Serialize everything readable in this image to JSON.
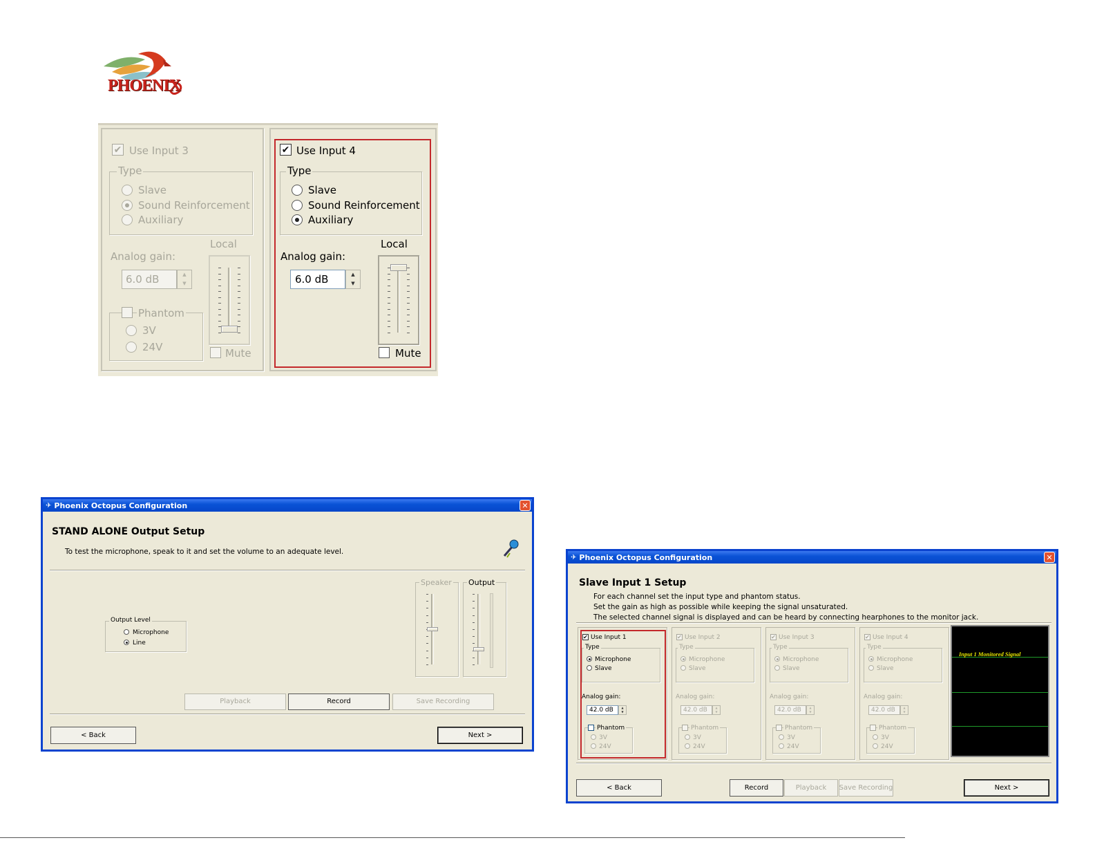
{
  "logo": {
    "text": "PHOENIX"
  },
  "closeup": {
    "left": {
      "use_label": "Use Input 3",
      "type_legend": "Type",
      "types": [
        "Slave",
        "Sound Reinforcement",
        "Auxiliary"
      ],
      "selected": 1,
      "gain_label": "Analog gain:",
      "gain_value": "6.0 dB",
      "local_label": "Local",
      "phantom_label": "Phantom",
      "phantom_options": [
        "3V",
        "24V"
      ],
      "mute_label": "Mute",
      "slider_level": 0.05
    },
    "right": {
      "use_label": "Use Input 4",
      "type_legend": "Type",
      "types": [
        "Slave",
        "Sound Reinforcement",
        "Auxiliary"
      ],
      "selected": 2,
      "gain_label": "Analog gain:",
      "gain_value": "6.0 dB",
      "local_label": "Local",
      "mute_label": "Mute",
      "slider_level": 1.0
    }
  },
  "win1": {
    "title": "Phoenix Octopus Configuration",
    "heading": "STAND ALONE Output Setup",
    "desc": "To test the microphone, speak to it and set the volume to an adequate level.",
    "output_level_legend": "Output Level",
    "options": [
      "Microphone",
      "Line"
    ],
    "selected": 1,
    "speaker_label": "Speaker",
    "output_label": "Output",
    "buttons": {
      "playback": "Playback",
      "record": "Record",
      "save": "Save Recording",
      "back": "< Back",
      "next": "Next >"
    }
  },
  "win2": {
    "title": "Phoenix Octopus Configuration",
    "heading": "Slave Input 1 Setup",
    "desc": [
      "For each channel set the input type and phantom status.",
      "Set the gain as high as possible while keeping the signal unsaturated.",
      "The selected channel signal is displayed and can be heard by connecting hearphones to the monitor jack."
    ],
    "channels": [
      {
        "use_label": "Use Input 1",
        "enabled": true
      },
      {
        "use_label": "Use Input 2",
        "enabled": false
      },
      {
        "use_label": "Use Input 3",
        "enabled": false
      },
      {
        "use_label": "Use Input 4",
        "enabled": false
      }
    ],
    "type_legend": "Type",
    "types": [
      "Microphone",
      "Slave"
    ],
    "gain_label": "Analog gain:",
    "gain_value": "42.0 dB",
    "phantom_label": "Phantom",
    "phantom_options": [
      "3V",
      "24V"
    ],
    "monitor_label": "Input 1 Monitored Signal",
    "buttons": {
      "back": "< Back",
      "record": "Record",
      "playback": "Playback",
      "save": "Save Recording",
      "next": "Next >"
    }
  },
  "colors": {
    "window_border": "#0a43cf",
    "highlight_red": "#c3282b",
    "dialog_bg": "#ece9d8",
    "monitor_green": "#1f9a2a",
    "monitor_text": "#e8e800"
  }
}
